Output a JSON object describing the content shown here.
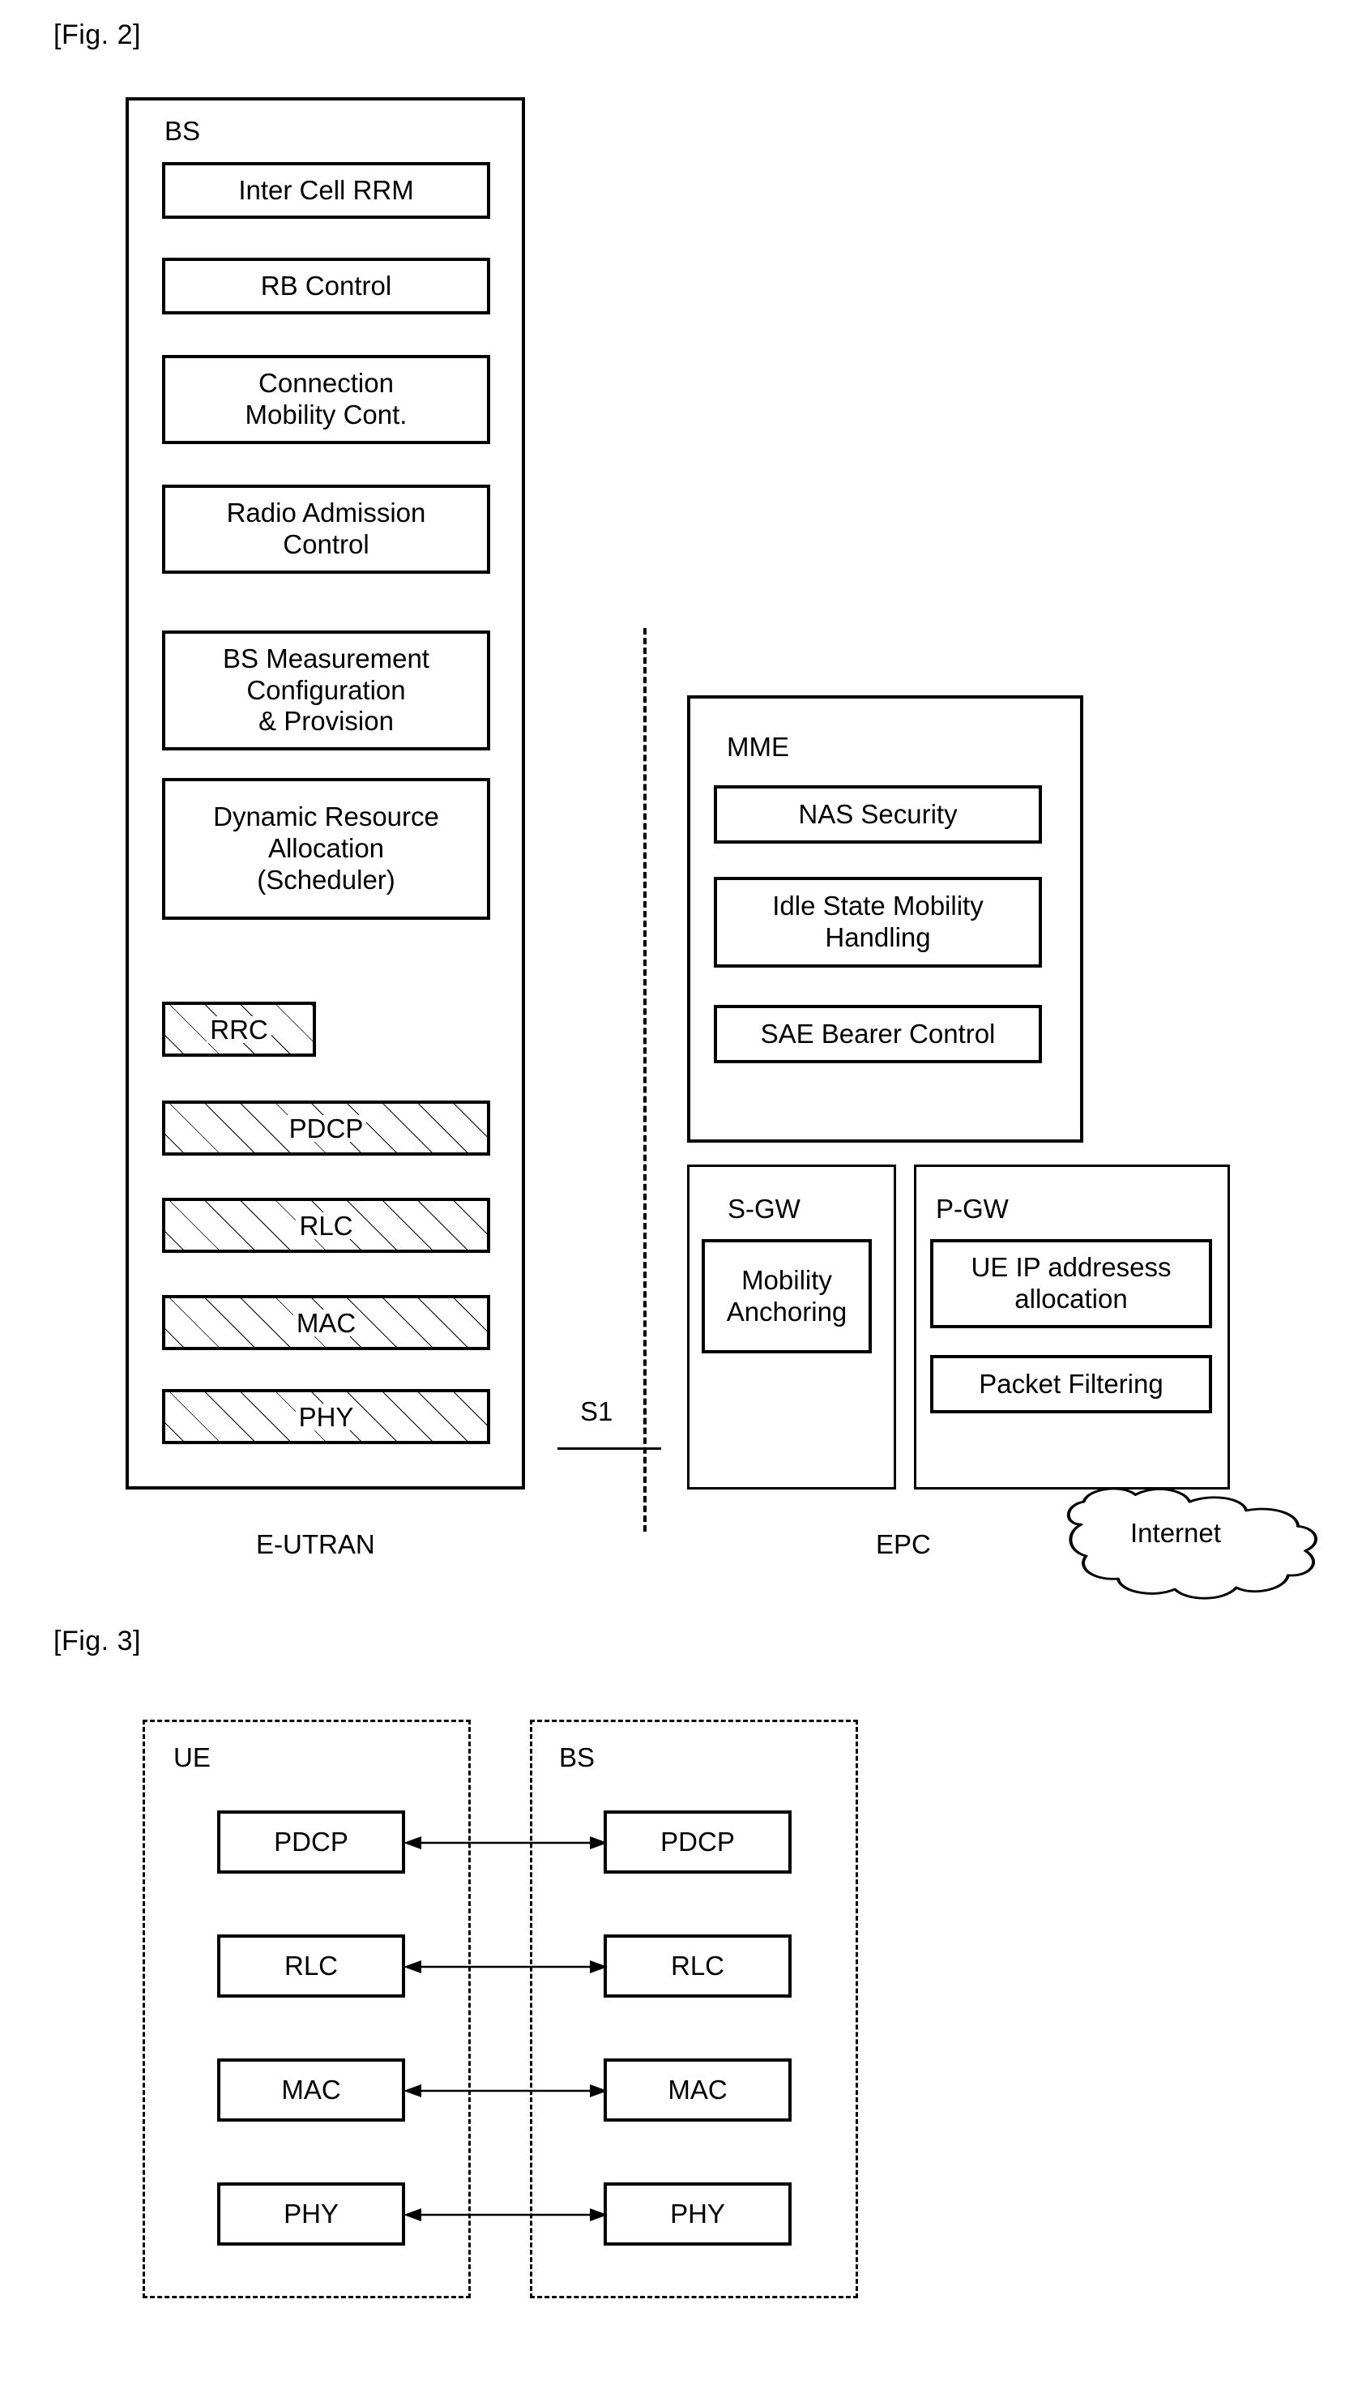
{
  "figures": [
    {
      "id": "fig2",
      "label": "[Fig. 2]",
      "eutran": {
        "container_title": "BS",
        "caption": "E-UTRAN",
        "functions": [
          {
            "lines": [
              "Inter Cell RRM"
            ]
          },
          {
            "lines": [
              "RB Control"
            ]
          },
          {
            "lines": [
              "Connection",
              "Mobility Cont."
            ]
          },
          {
            "lines": [
              "Radio Admission",
              "Control"
            ]
          },
          {
            "lines": [
              "BS Measurement",
              "Configuration",
              "& Provision"
            ]
          },
          {
            "lines": [
              "Dynamic Resource",
              "Allocation",
              "(Scheduler)"
            ]
          }
        ],
        "stack": [
          {
            "label": "RRC"
          },
          {
            "label": "PDCP"
          },
          {
            "label": "RLC"
          },
          {
            "label": "MAC"
          },
          {
            "label": "PHY"
          }
        ]
      },
      "interface": {
        "label": "S1"
      },
      "epc": {
        "caption": "EPC",
        "mme": {
          "container_title": "MME",
          "functions": [
            {
              "lines": [
                "NAS Security"
              ]
            },
            {
              "lines": [
                "Idle State Mobility",
                "Handling"
              ]
            },
            {
              "lines": [
                "SAE Bearer Control"
              ]
            }
          ]
        },
        "sgw": {
          "container_title": "S-GW",
          "functions": [
            {
              "lines": [
                "Mobility",
                "Anchoring"
              ]
            }
          ]
        },
        "pgw": {
          "container_title": "P-GW",
          "functions": [
            {
              "lines": [
                "UE IP addresess",
                "allocation"
              ]
            },
            {
              "lines": [
                "Packet Filtering"
              ]
            }
          ]
        },
        "cloud": {
          "label": "Internet"
        }
      }
    },
    {
      "id": "fig3",
      "label": "[Fig. 3]",
      "left": {
        "container_title": "UE",
        "layers": [
          "PDCP",
          "RLC",
          "MAC",
          "PHY"
        ]
      },
      "right": {
        "container_title": "BS",
        "layers": [
          "PDCP",
          "RLC",
          "MAC",
          "PHY"
        ]
      },
      "connectors": [
        "bidirectional",
        "bidirectional",
        "bidirectional",
        "bidirectional"
      ]
    }
  ],
  "colors": {
    "stroke": "#000000",
    "background": "#ffffff"
  }
}
